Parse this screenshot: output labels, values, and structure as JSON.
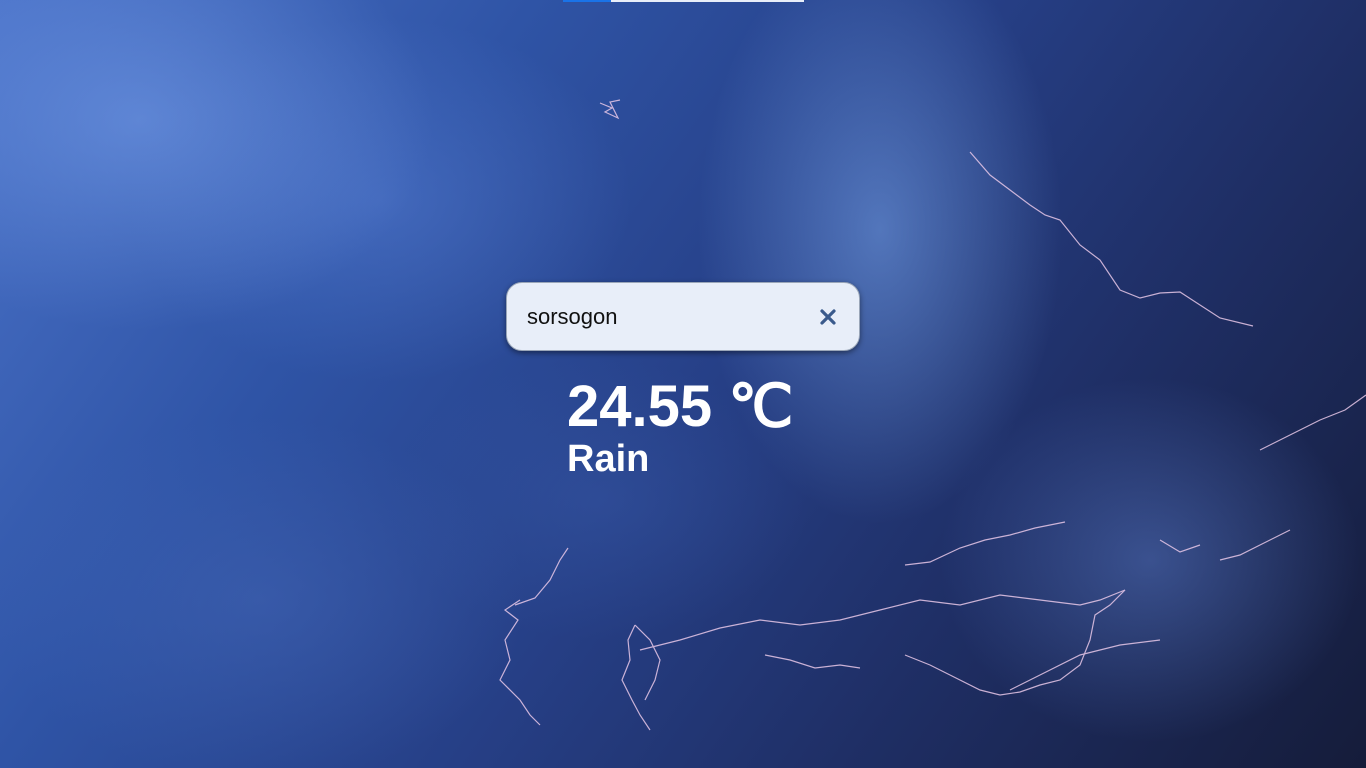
{
  "search": {
    "value": "sorsogon",
    "placeholder": ""
  },
  "weather": {
    "temperature": "24.55",
    "unit": "℃",
    "condition": "Rain"
  },
  "icons": {
    "clear": "close-icon"
  },
  "colors": {
    "search_bg": "#e8eef9",
    "clear_icon": "#3a5a8c",
    "text": "#ffffff"
  }
}
